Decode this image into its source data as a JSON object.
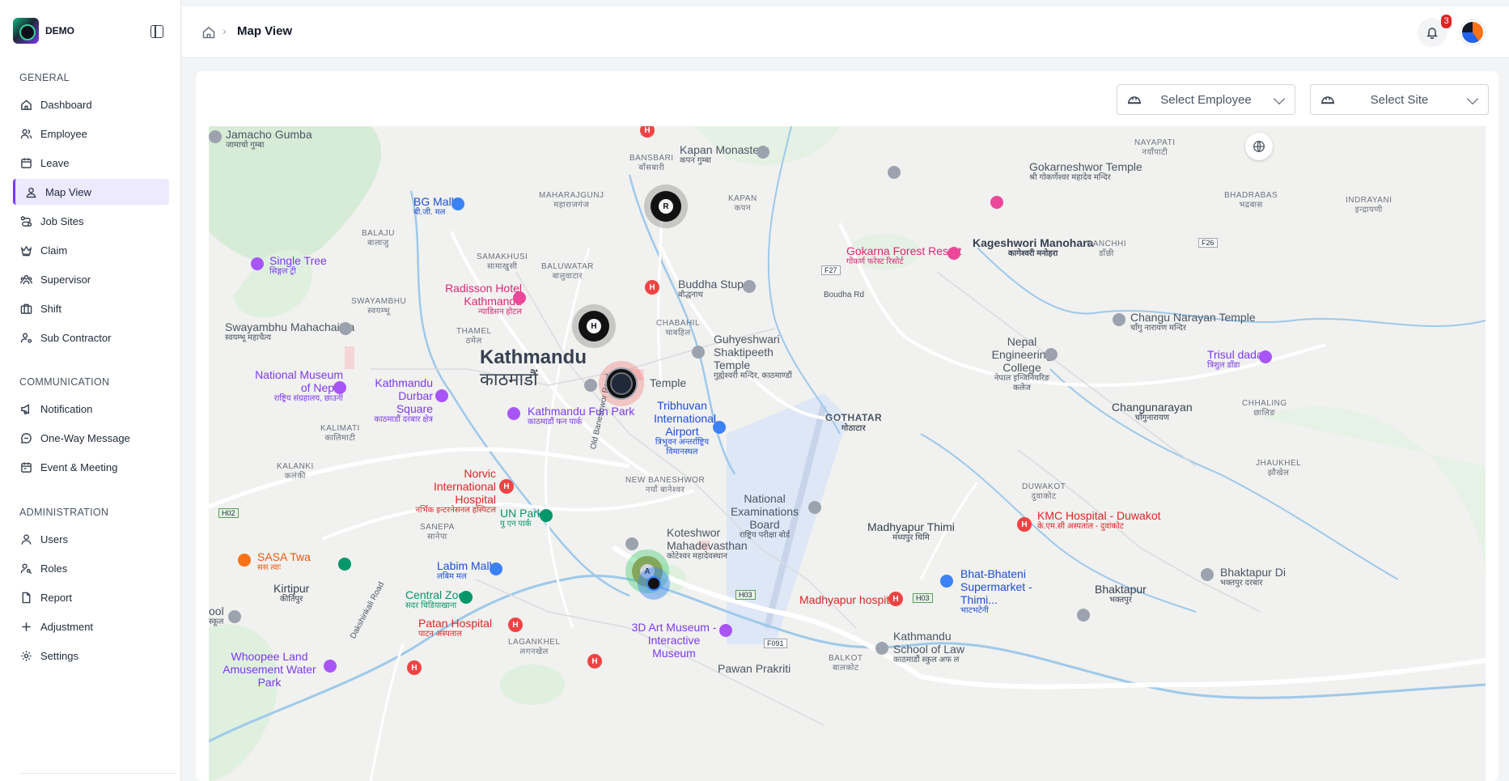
{
  "brand": {
    "name": "DEMO"
  },
  "sidebar": {
    "sections": [
      {
        "title": "GENERAL",
        "items": [
          {
            "label": "Dashboard",
            "icon": "home-icon"
          },
          {
            "label": "Employee",
            "icon": "users-icon"
          },
          {
            "label": "Leave",
            "icon": "calendar-icon"
          },
          {
            "label": "Map View",
            "icon": "map-pin-user-icon",
            "active": true
          },
          {
            "label": "Job Sites",
            "icon": "route-icon"
          },
          {
            "label": "Claim",
            "icon": "crown-icon"
          },
          {
            "label": "Supervisor",
            "icon": "team-icon"
          },
          {
            "label": "Shift",
            "icon": "briefcase-icon"
          },
          {
            "label": "Sub Contractor",
            "icon": "user-gear-icon"
          }
        ]
      },
      {
        "title": "COMMUNICATION",
        "items": [
          {
            "label": "Notification",
            "icon": "megaphone-icon"
          },
          {
            "label": "One-Way Message",
            "icon": "message-icon"
          },
          {
            "label": "Event & Meeting",
            "icon": "calendar-event-icon"
          }
        ]
      },
      {
        "title": "ADMINISTRATION",
        "items": [
          {
            "label": "Users",
            "icon": "user-icon"
          },
          {
            "label": "Roles",
            "icon": "user-key-icon"
          },
          {
            "label": "Report",
            "icon": "file-icon"
          },
          {
            "label": "Adjustment",
            "icon": "plus-icon"
          },
          {
            "label": "Settings",
            "icon": "gear-icon"
          }
        ]
      }
    ]
  },
  "header": {
    "breadcrumb_title": "Map View",
    "notification_count": "3"
  },
  "filters": {
    "employee_placeholder": "Select Employee",
    "site_placeholder": "Select Site"
  },
  "map": {
    "markers": [
      "R",
      "H",
      "A"
    ],
    "labels": {
      "kathmandu": "Kathmandu",
      "kathmandu_np": "काठमाडौं",
      "jamacho": "Jamacho Gumba",
      "jamacho_np": "जामाचो गुम्बा",
      "bgmall": "BG Mall",
      "bgmall_np": "बी.जी. मल",
      "bansbari": "BANSBARI",
      "bansbari_np": "बाँसबारी",
      "kapan_mon": "Kapan Monastery",
      "kapan_mon_np": "कपन गुम्बा",
      "gokarneshwor": "Gokarneshwor Temple",
      "gokarneshwor_np": "श्री गोकर्णेश्वर महादेव मन्दिर",
      "nayapati": "NAYAPATI",
      "nayapati_np": "नयाँपाटी",
      "maharajgunj": "MAHARAJGUNJ",
      "maharajgunj_np": "महाराजगंज",
      "kapan": "KAPAN",
      "kapan_np": "कपन",
      "bhadrabas": "BHADRABAS",
      "bhadrabas_np": "भद्रबास",
      "indrayani": "INDRAYANI",
      "indrayani_np": "इन्द्रायणी",
      "balaju": "BALAJU",
      "balaju_np": "बालाजु",
      "singletree": "Single Tree",
      "singletree_np": "सिङ्गल ट्री",
      "gokarna": "Gokarna Forest Resort",
      "gokarna_np": "गोकर्ण फरेस्ट रिसोर्ट",
      "kageshwori": "Kageshwori Manohara",
      "kageshwori_np": "कागेश्वरी मनोहरा",
      "danchhi": "DANCHHI",
      "danchhi_np": "डाँछी",
      "samakhusi": "SAMAKHUSI",
      "samakhusi_np": "सामाखुसी",
      "baluwatar": "BALUWATAR",
      "baluwatar_np": "बालुवाटार",
      "radisson": "Radisson Hotel Kathmandu",
      "radisson_np": "न्याडिसन होटल",
      "buddha": "Buddha Stupa",
      "buddha_np": "बौद्धनाथ",
      "boudha_rd": "Boudha Rd",
      "swayambhu": "SWAYAMBHU",
      "swayambhu_np": "स्वयम्भू",
      "swayambhu_chaitya": "Swayambhu Mahachaitya",
      "swayambhu_chaitya_np": "स्वयम्भू महाचैत्य",
      "chabahil": "CHABAHIL",
      "chabahil_np": "चाबहिल",
      "guhyeshwari": "Guhyeshwari Shaktipeeth Temple",
      "guhyeshwari_np": "गुह्येश्वरी मन्दिर, काठमाण्डौं",
      "changu": "Changu Narayan Temple",
      "changu_np": "चाँगु नारायण मन्दिर",
      "thamel": "THAMEL",
      "thamel_np": "ठमेल",
      "nepal_eng": "Nepal Engineering College",
      "nepal_eng_np": "नेपाल इन्जिनियरिङ कलेज",
      "trisul": "Trisul dada",
      "trisul_np": "त्रिशुल डाँडा",
      "nat_museum": "National Museum of Nepal",
      "nat_museum_np": "राष्ट्रिय संग्रहालय, छाउनी",
      "durbar": "Kathmandu Durbar Square",
      "durbar_np": "काठमाडौं दरबार क्षेत्र",
      "temple": "Temple",
      "funpark": "Kathmandu Fun Park",
      "funpark_np": "काठमाडौं फन पार्क",
      "airport": "Tribhuvan International Airport",
      "airport_np": "त्रिभुवन अन्तर्राष्ट्रिय विमानस्थल",
      "gothatar": "GOTHATAR",
      "gothatar_np": "गोठाटार",
      "changunarayan": "Changunarayan",
      "changunarayan_np": "चाँगुनारायण",
      "chhalling": "CHHALING",
      "chhalling_np": "छालिङ",
      "kalimati": "KALIMATI",
      "kalimati_np": "कालिमाटी",
      "old_baneshwor": "Old Baneshwor Road",
      "jhaukhel": "JHAUKHEL",
      "jhaukhel_np": "झौखेल",
      "kalanki": "KALANKI",
      "kalanki_np": "कलंकी",
      "norvic": "Norvic International Hospital",
      "norvic_np": "नर्भिक इन्टरनेसनल हस्पिटल",
      "new_baneshwor": "NEW BANESHWOR",
      "new_baneshwor_np": "नयाँ बानेश्वर",
      "duwakot": "DUWAKOT",
      "duwakot_np": "दुवाकोट",
      "unpark": "UN Park",
      "unpark_np": "यु एन पार्क",
      "nat_exam": "National Examinations Board",
      "nat_exam_np": "राष्ट्रिय परीक्षा बोर्ड",
      "kmc": "KMC Hospital - Duwakot",
      "kmc_np": "के.एम.सी अस्पताल - दुवाकोट",
      "sanepa": "SANEPA",
      "sanepa_np": "सानेपा",
      "koteshwor": "Koteshwor Mahadevasthan",
      "koteshwor_np": "कोटेश्वर महादेवस्थान",
      "madhyapur": "Madhyapur Thimi",
      "madhyapur_np": "मध्यपुर थिमि",
      "sasa": "SASA Twa",
      "sasa_np": "सस त्वाः",
      "labim": "Labim Mall",
      "labim_np": "लबिम मल",
      "kirtipur": "Kirtipur",
      "kirtipur_np": "कीर्तिपुर",
      "dakshinkali": "Dakshinkali Road",
      "central_zoo": "Central Zoo",
      "central_zoo_np": "सदर चिडियाखाना",
      "bhatbhateni": "Bhat-Bhateni Supermarket - Thimi...",
      "bhatbhateni_np": "भाटभटेनी",
      "bhaktapur_di": "Bhaktapur Di",
      "bhaktapur_di_np": "भक्तपुर दरबार",
      "madhyapur_hosp": "Madhyapur hospital",
      "bhaktapur": "Bhaktapur",
      "bhaktapur_np": "भक्तपुर",
      "patan": "Patan Hospital",
      "patan_np": "पाटन अस्पताल",
      "art_museum": "3D Art Museum - Interactive Museum",
      "lagankhel": "LAGANKHEL",
      "lagankhel_np": "लगनखेल",
      "school": "ool",
      "school_np": "स्कूल",
      "ksl": "Kathmandu School of Law",
      "ksl_np": "काठमाडौं स्कुल अफ ल",
      "whoopee": "Whoopee Land Amusement Water Park",
      "balkot": "BALKOT",
      "balkot_np": "बालकोट",
      "pawan": "Pawan Prakriti",
      "r_f27": "F27",
      "r_f26": "F26",
      "r_h02": "H02",
      "r_h03a": "H03",
      "r_h03b": "H03",
      "r_f091": "F091",
      "hospital_top": "H"
    }
  },
  "colors": {
    "accent": "#7c3aed",
    "active_bg": "#ede9fe",
    "badge": "#dc2626"
  }
}
